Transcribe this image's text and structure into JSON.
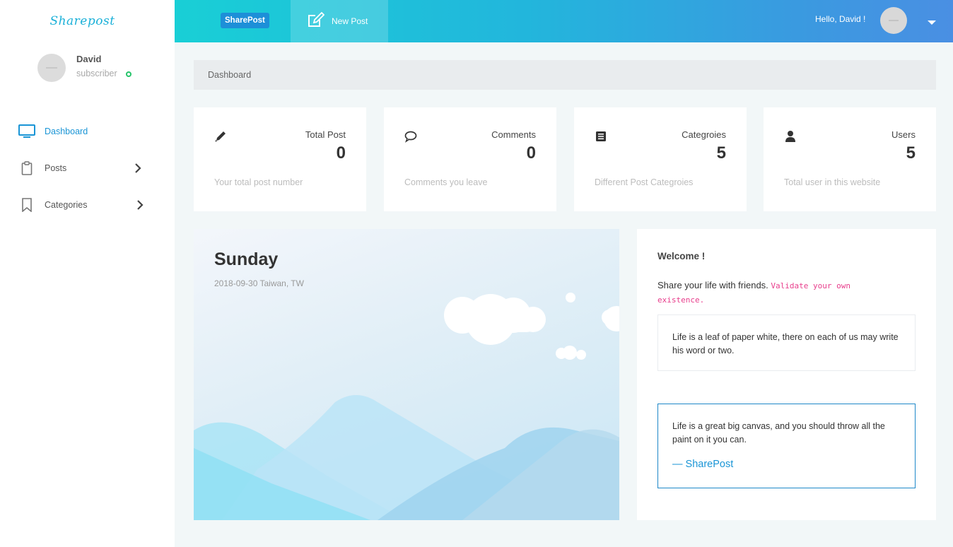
{
  "app": {
    "logo_text": "Sharepost"
  },
  "sidebar": {
    "profile": {
      "name": "David",
      "role": "subscriber"
    },
    "items": [
      {
        "label": "Dashboard",
        "icon": "monitor-icon",
        "active": true
      },
      {
        "label": "Posts",
        "icon": "clipboard-icon",
        "has_children": true
      },
      {
        "label": "Categories",
        "icon": "bookmark-icon",
        "has_children": true
      }
    ]
  },
  "topbar": {
    "brand_label": "SharePost",
    "new_post_label": "New Post",
    "greeting": "Hello, David !"
  },
  "breadcrumb": {
    "current": "Dashboard"
  },
  "stats": [
    {
      "title": "Total Post",
      "value": "0",
      "description": "Your total post number",
      "icon": "pencil-icon"
    },
    {
      "title": "Comments",
      "value": "0",
      "description": "Comments you leave",
      "icon": "comment-icon"
    },
    {
      "title": "Categroies",
      "value": "5",
      "description": "Different Post Categroies",
      "icon": "list-icon"
    },
    {
      "title": "Users",
      "value": "5",
      "description": "Total user in this website",
      "icon": "user-icon"
    }
  ],
  "weather": {
    "day": "Sunday",
    "date_location": "2018-09-30 Taiwan, TW"
  },
  "welcome": {
    "title": "Welcome !",
    "text": "Share your life with friends.",
    "code": "Validate your own existence.",
    "quote": "Life is a leaf of paper white, there on each of us may write his word or two.",
    "blockquote": "Life is a great big canvas, and you should throw all the paint on it you can.",
    "blockquote_footer": "— SharePost"
  },
  "colors": {
    "accent": "#1a95d6",
    "online": "#27c46b",
    "code": "#e83e8c"
  }
}
